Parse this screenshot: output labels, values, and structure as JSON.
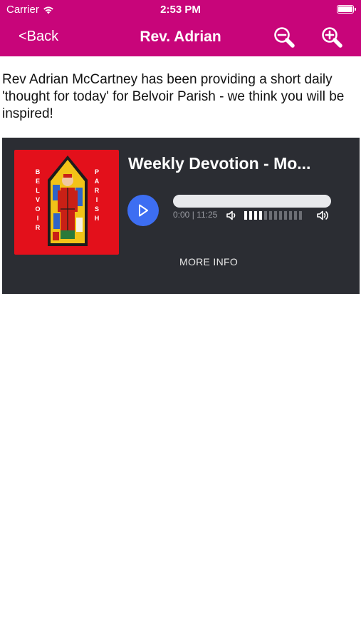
{
  "status_bar": {
    "carrier": "Carrier",
    "time": "2:53 PM"
  },
  "nav": {
    "back_label": "<Back",
    "title": "Rev. Adrian",
    "zoom_out_icon": "zoom-out-icon",
    "zoom_in_icon": "zoom-in-icon"
  },
  "content": {
    "description": "Rev Adrian McCartney has been providing a short daily 'thought for today' for Belvoir Parish - we think you will be inspired!"
  },
  "player": {
    "artwork": {
      "left_text": "BELVOIR",
      "right_text": "PARISH"
    },
    "episode_title": "Weekly Devotion - Mo...",
    "current_time": "0:00",
    "duration": "11:25",
    "progress": 0,
    "volume_level": 0.3,
    "more_info_label": "MORE INFO",
    "colors": {
      "background": "#2b2d33",
      "play_button": "#3d6ef2",
      "artwork_bg": "#e3101b"
    }
  },
  "colors": {
    "brand": "#c8057a"
  }
}
